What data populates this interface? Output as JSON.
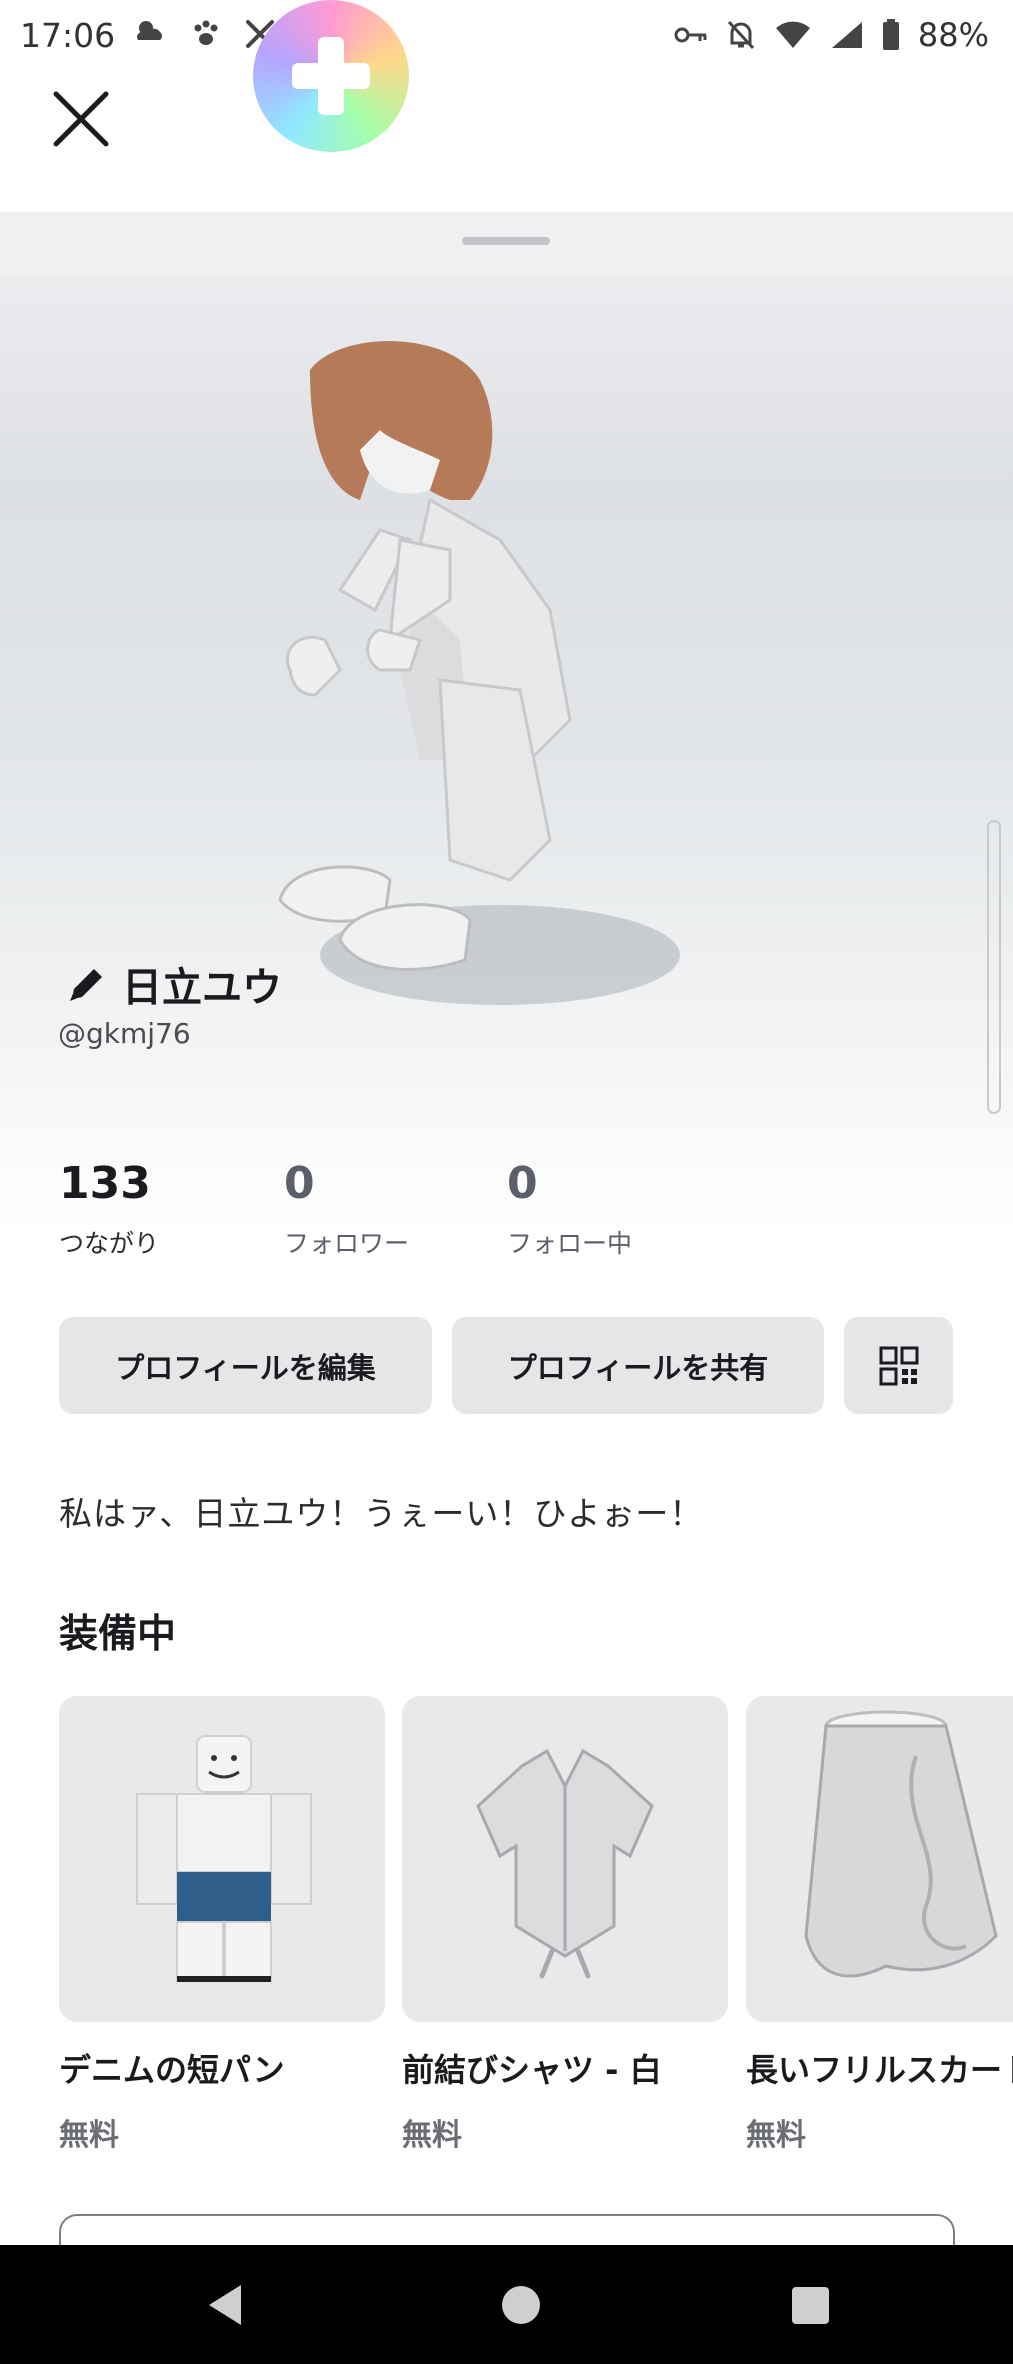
{
  "status_bar": {
    "time": "17:06",
    "battery": "88%",
    "left_icons": [
      "weather-icon",
      "paw-icon",
      "tools-icon"
    ],
    "right_icons": [
      "key-icon",
      "bell-off-icon",
      "wifi-icon",
      "signal-icon",
      "battery-icon"
    ]
  },
  "overlay": {
    "gamepad_icon": "gamepad-icon"
  },
  "header": {
    "close_icon": "close-icon"
  },
  "profile": {
    "display_name": "日立ユウ",
    "edit_icon": "pencil-icon",
    "username": "@gkmj76",
    "stats": [
      {
        "value": "133",
        "label": "つながり"
      },
      {
        "value": "0",
        "label": "フォロワー"
      },
      {
        "value": "0",
        "label": "フォロー中"
      }
    ],
    "actions": {
      "edit_label": "プロフィールを編集",
      "share_label": "プロフィールを共有",
      "qr_icon": "qr-code-icon"
    },
    "bio": "私はァ、日立ユウ！うぇーい！ひよぉー！"
  },
  "equipped": {
    "title": "装備中",
    "items": [
      {
        "name": "デニムの短パン",
        "price": "無料"
      },
      {
        "name": "前結びシャツ - 白",
        "price": "無料"
      },
      {
        "name": "長いフリルスカート",
        "price": "無料"
      }
    ]
  },
  "nav": {
    "back_icon": "back-icon",
    "home_icon": "home-icon",
    "recents_icon": "recents-icon"
  }
}
